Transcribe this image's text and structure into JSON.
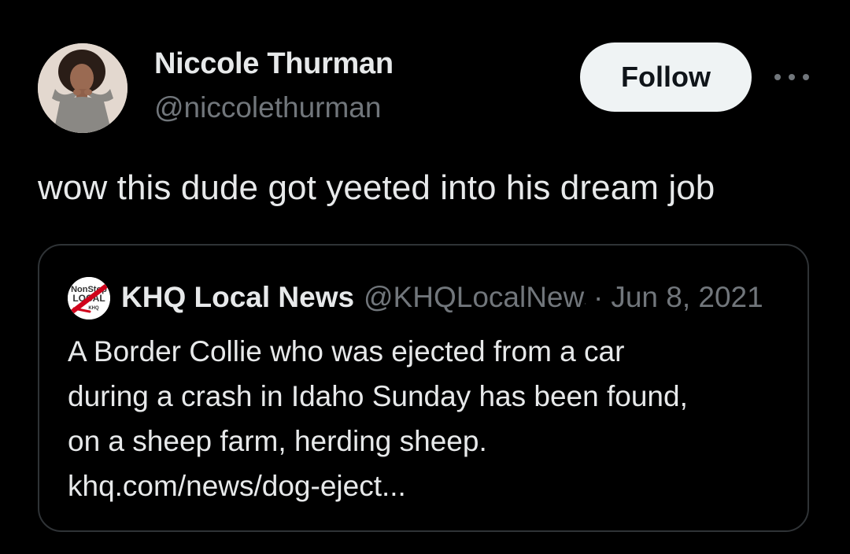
{
  "author": {
    "display_name": "Niccole Thurman",
    "handle": "@niccolethurman",
    "avatar_icon": "profile-photo"
  },
  "follow_button": {
    "label": "Follow",
    "background": "#eff3f4",
    "text_color": "#0f1419"
  },
  "more_menu_icon": "more-horizontal-icon",
  "tweet": {
    "text": "wow this dude got yeeted into his dream job"
  },
  "quoted_tweet": {
    "author_name": "KHQ Local News",
    "author_handle": "@KHQLocalNews",
    "separator": "·",
    "date": "Jun 8, 2021",
    "avatar_text": {
      "line1": "NonStop",
      "line2": "LOCAL",
      "line3": "KHQ"
    },
    "body_lines": [
      "A Border Collie who was ejected from a car",
      "during a crash in Idaho Sunday has been found,",
      "on a sheep farm, herding sheep.",
      "khq.com/news/dog-eject..."
    ]
  },
  "colors": {
    "background": "#000000",
    "primary_text": "#e7e9ea",
    "secondary_text": "#71767b",
    "border": "#2f3336",
    "brand_red": "#d0021b"
  }
}
